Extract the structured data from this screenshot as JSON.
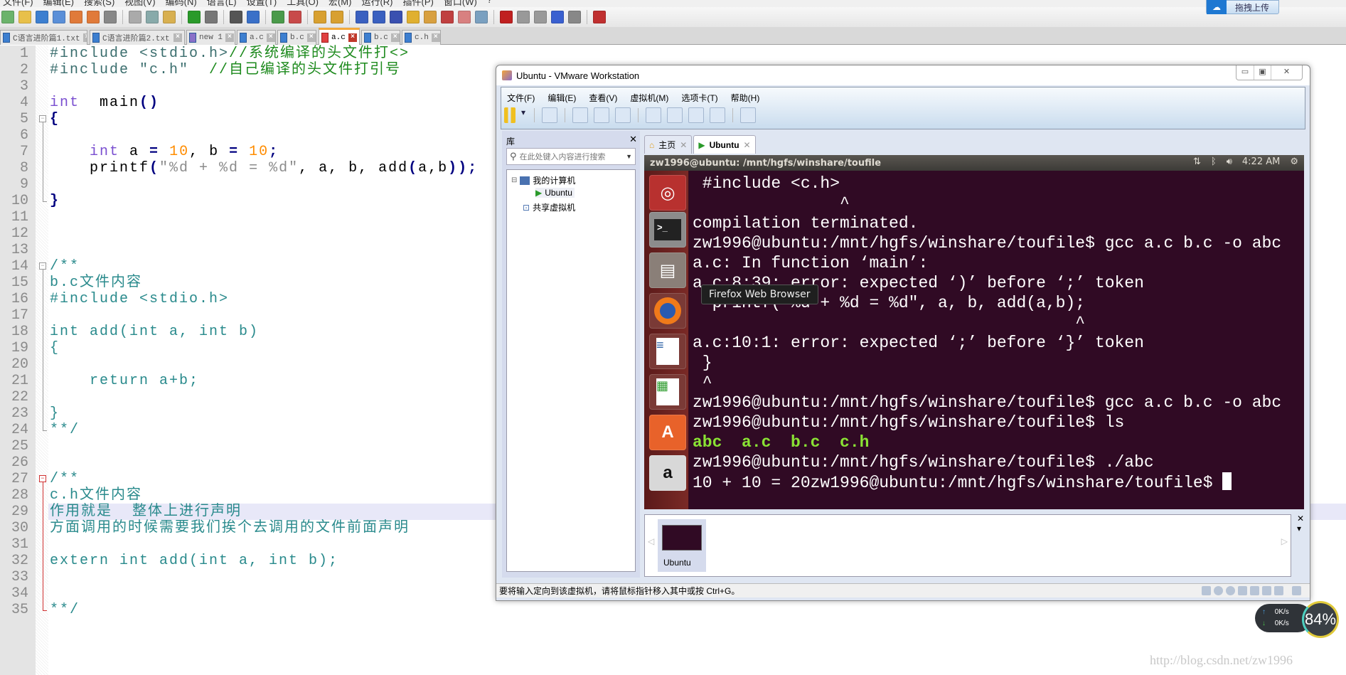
{
  "npp": {
    "menu": [
      "文件(F)",
      "编辑(E)",
      "搜索(S)",
      "视图(V)",
      "编码(N)",
      "语言(L)",
      "设置(T)",
      "工具(O)",
      "宏(M)",
      "运行(R)",
      "插件(P)",
      "窗口(W)",
      "?"
    ],
    "tabs": [
      {
        "label": "C语言进阶篇1.txt",
        "active": false
      },
      {
        "label": "C语言进阶篇2.txt",
        "active": false
      },
      {
        "label": "new 1",
        "active": false
      },
      {
        "label": "a.c",
        "active": false
      },
      {
        "label": "b.c",
        "active": false
      },
      {
        "label": "a.c",
        "active": true
      },
      {
        "label": "b.c",
        "active": false
      },
      {
        "label": "c.h",
        "active": false
      }
    ],
    "highlighted_line": 29,
    "code": [
      [
        [
          "#include <stdio.h>",
          "pre"
        ],
        [
          "//系统编译的头文件打<>",
          "cm"
        ]
      ],
      [
        [
          "#include \"c.h\"  ",
          "pre"
        ],
        [
          "//自己编译的头文件打引号",
          "cm"
        ]
      ],
      [],
      [
        [
          "int",
          "kw"
        ],
        [
          "  main",
          "tx"
        ],
        [
          "()",
          "op"
        ]
      ],
      [
        [
          "{",
          "op"
        ]
      ],
      [],
      [
        [
          "    ",
          "tx"
        ],
        [
          "int",
          "kw"
        ],
        [
          " a ",
          "tx"
        ],
        [
          "=",
          "op"
        ],
        [
          " ",
          "tx"
        ],
        [
          "10",
          "num"
        ],
        [
          ", b ",
          "tx"
        ],
        [
          "=",
          "op"
        ],
        [
          " ",
          "tx"
        ],
        [
          "10",
          "num"
        ],
        [
          ";",
          "op"
        ]
      ],
      [
        [
          "    printf",
          "tx"
        ],
        [
          "(",
          "op"
        ],
        [
          "\"%d + %d = %d\"",
          "str"
        ],
        [
          ", a, b, add",
          "tx"
        ],
        [
          "(",
          "op"
        ],
        [
          "a,b",
          "tx"
        ],
        [
          "));",
          "op"
        ]
      ],
      [],
      [
        [
          "}",
          "op"
        ]
      ],
      [],
      [],
      [],
      [
        [
          "/**",
          "blk"
        ]
      ],
      [
        [
          "b.c文件内容",
          "blk"
        ]
      ],
      [
        [
          "#include <stdio.h>",
          "blk"
        ]
      ],
      [],
      [
        [
          "int add(int a, int b)",
          "blk"
        ]
      ],
      [
        [
          "{",
          "blk"
        ]
      ],
      [],
      [
        [
          "    return a+b;",
          "blk"
        ]
      ],
      [],
      [
        [
          "}",
          "blk"
        ]
      ],
      [
        [
          "**/",
          "blk"
        ]
      ],
      [],
      [],
      [
        [
          "/**",
          "blk"
        ]
      ],
      [
        [
          "c.h文件内容",
          "blk"
        ]
      ],
      [
        [
          "作用就是  整体上进行声明",
          "blk"
        ]
      ],
      [
        [
          "方面调用的时候需要我们挨个去调用的文件前面声明",
          "blk"
        ]
      ],
      [],
      [
        [
          "extern int add(int a, int b);",
          "blk"
        ]
      ],
      [],
      [],
      [
        [
          "**/",
          "blk"
        ]
      ]
    ]
  },
  "vmware": {
    "title": "Ubuntu - VMware Workstation",
    "menu": [
      "文件(F)",
      "编辑(E)",
      "查看(V)",
      "虚拟机(M)",
      "选项卡(T)",
      "帮助(H)"
    ],
    "library": {
      "title": "库",
      "search_placeholder": "在此处键入内容进行搜索",
      "tree": [
        "我的计算机",
        "Ubuntu",
        "共享虚拟机"
      ]
    },
    "tabs": [
      {
        "label": "主页",
        "active": false
      },
      {
        "label": "Ubuntu",
        "active": true
      }
    ],
    "ubuntu_bar": {
      "title": "zw1996@ubuntu: /mnt/hgfs/winshare/toufile",
      "time": "4:22 AM"
    },
    "launcher_tooltip": "Firefox Web Browser",
    "terminal": [
      " #include <c.h>",
      "               ^",
      "compilation terminated.",
      "zw1996@ubuntu:/mnt/hgfs/winshare/toufile$ gcc a.c b.c -o abc",
      "a.c: In function ‘main’:",
      "a.c:8:39: error: expected ‘)’ before ‘;’ token",
      "  printf(\"%d + %d = %d\", a, b, add(a,b);",
      "                                       ^",
      "a.c:10:1: error: expected ‘;’ before ‘}’ token",
      " }",
      " ^",
      "zw1996@ubuntu:/mnt/hgfs/winshare/toufile$ gcc a.c b.c -o abc",
      "zw1996@ubuntu:/mnt/hgfs/winshare/toufile$ ls",
      "abc  a.c  b.c  c.h",
      "zw1996@ubuntu:/mnt/hgfs/winshare/toufile$ ./abc",
      "10 + 10 = 20zw1996@ubuntu:/mnt/hgfs/winshare/toufile$ "
    ],
    "terminal_green_line": 13,
    "thumbnail_label": "Ubuntu",
    "status": "要将输入定向到该虚拟机，请将鼠标指针移入其中或按 Ctrl+G。"
  },
  "net_widget": {
    "up": "0K/s",
    "down": "0K/s",
    "percent": "84%"
  },
  "baidu_button": "拖拽上传",
  "watermark": "http://blog.csdn.net/zw1996",
  "colors": {
    "terminal_bg": "#300a24",
    "ls_green": "#8ae234",
    "active_tab": "#f2a93b"
  }
}
